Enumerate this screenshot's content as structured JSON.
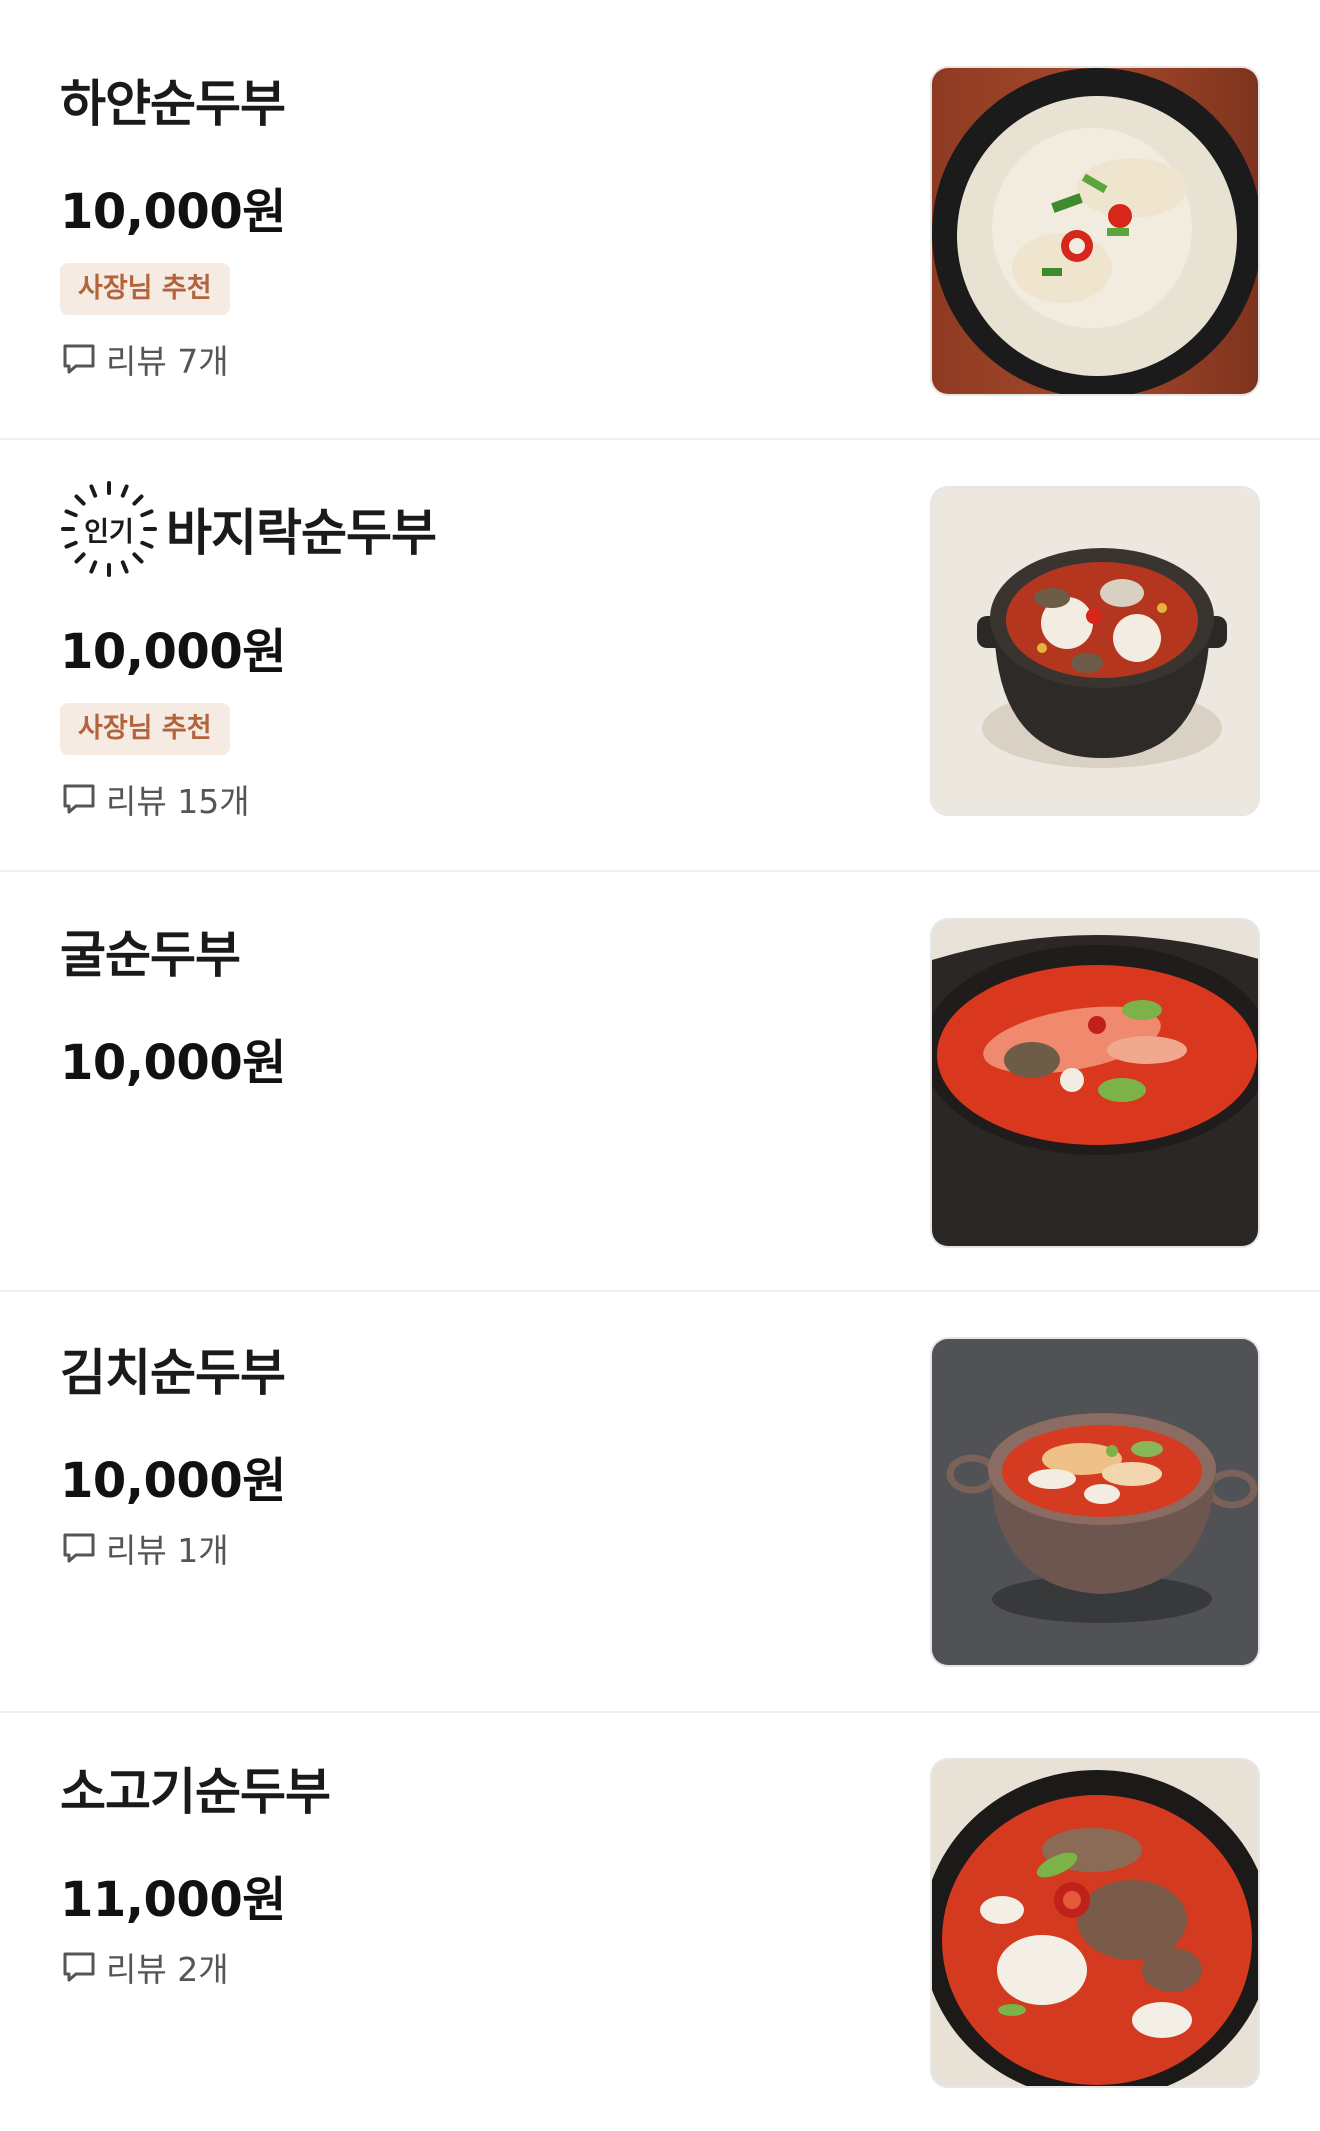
{
  "menu": {
    "items": [
      {
        "name": "하얀순두부",
        "price": "10,000원",
        "popular": false,
        "owner_badge": "사장님 추천",
        "review": "리뷰 7개",
        "image_icon": "white-sundubu-photo"
      },
      {
        "name": "바지락순두부",
        "price": "10,000원",
        "popular": true,
        "popular_label": "인기",
        "owner_badge": "사장님 추천",
        "review": "리뷰 15개",
        "image_icon": "clam-sundubu-photo"
      },
      {
        "name": "굴순두부",
        "price": "10,000원",
        "popular": false,
        "owner_badge": null,
        "review": null,
        "image_icon": "oyster-sundubu-photo"
      },
      {
        "name": "김치순두부",
        "price": "10,000원",
        "popular": false,
        "owner_badge": null,
        "review": "리뷰 1개",
        "image_icon": "kimchi-sundubu-photo"
      },
      {
        "name": "소고기순두부",
        "price": "11,000원",
        "popular": false,
        "owner_badge": null,
        "review": "리뷰 2개",
        "image_icon": "beef-sundubu-photo"
      }
    ]
  },
  "colors": {
    "owner_badge_bg": "#f6ebe3",
    "owner_badge_text": "#b2643c",
    "divider": "#efefef",
    "review_text": "#555555"
  }
}
